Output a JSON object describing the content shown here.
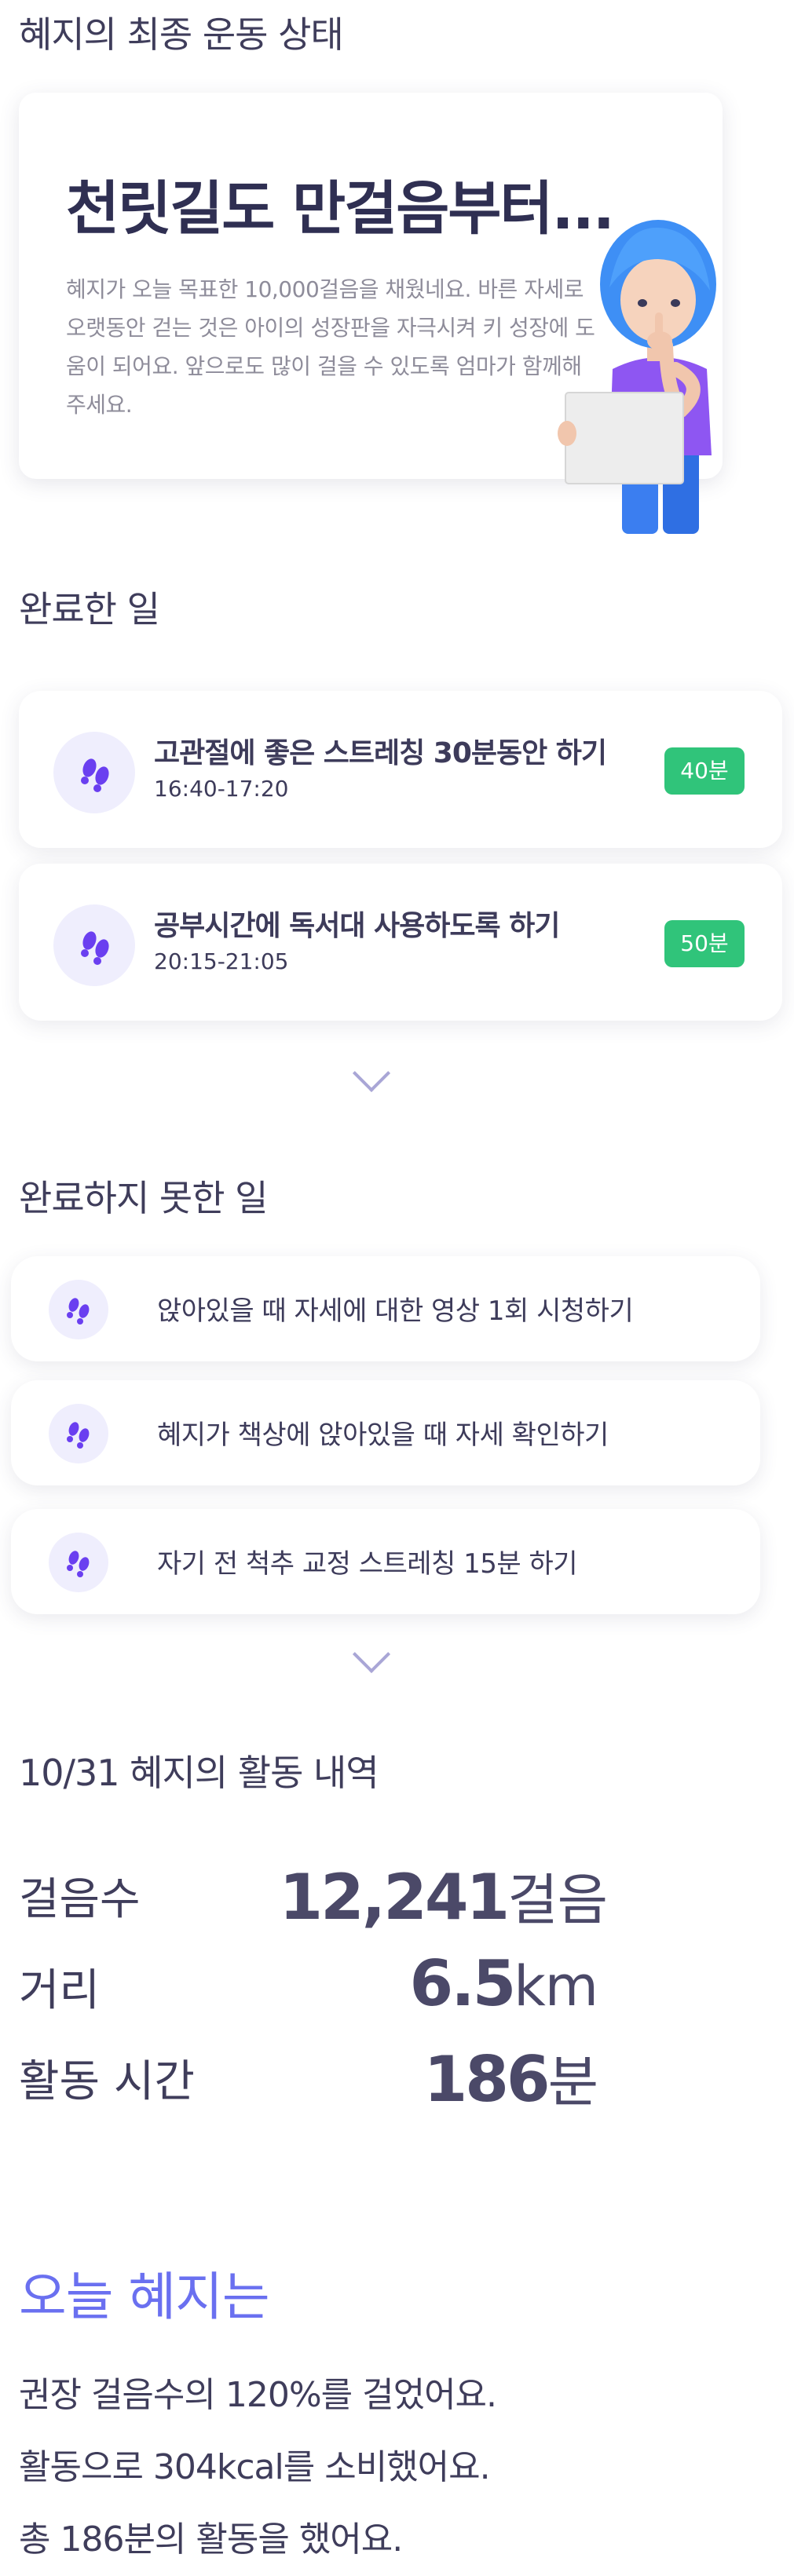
{
  "header": {
    "title": "혜지의 최종 운동 상태"
  },
  "hero": {
    "headline": "천릿길도 만걸음부터...",
    "body": "혜지가 오늘 목표한 10,000걸음을 채웠네요. 바른 자세로 오랫동안 걷는 것은 아이의 성장판을 자극시켜 키 성장에 도움이 되어요. 앞으로도 많이 걸을 수 있도록 엄마가 함께해 주세요."
  },
  "completed": {
    "title": "완료한 일",
    "items": [
      {
        "icon": "footprints-icon",
        "title": "고관절에 좋은 스트레칭 30분동안 하기",
        "time": "16:40-17:20",
        "duration": "40분"
      },
      {
        "icon": "footprints-icon",
        "title": "공부시간에 독서대 사용하도록 하기",
        "time": "20:15-21:05",
        "duration": "50분"
      }
    ]
  },
  "incomplete": {
    "title": "완료하지 못한 일",
    "items": [
      {
        "icon": "footprints-icon",
        "label": "앉아있을 때 자세에 대한 영상 1회 시청하기"
      },
      {
        "icon": "footprints-icon",
        "label": "혜지가 책상에 앉아있을 때 자세 확인하기"
      },
      {
        "icon": "footprints-icon",
        "label": "자기 전 척추 교정 스트레칭 15분 하기"
      }
    ]
  },
  "activity": {
    "title": "10/31 혜지의 활동 내역",
    "stats": [
      {
        "label": "걸음수",
        "value": "12,241",
        "unit": "걸음"
      },
      {
        "label": "거리",
        "value": "6.5",
        "unit": "km"
      },
      {
        "label": "활동 시간",
        "value": "186",
        "unit": "분"
      }
    ]
  },
  "today": {
    "title": "오늘 혜지는",
    "lines": [
      "권장 걸음수의 120%를 걸었어요.",
      "활동으로 304kcal를 소비했어요.",
      "총 186분의 활동을 했어요."
    ]
  },
  "colors": {
    "accent": "#6a70f0",
    "badge_green": "#30c47a",
    "icon_purple": "#6a3ff0",
    "icon_bg": "#efeefd",
    "text_dark": "#3f3d5b"
  }
}
